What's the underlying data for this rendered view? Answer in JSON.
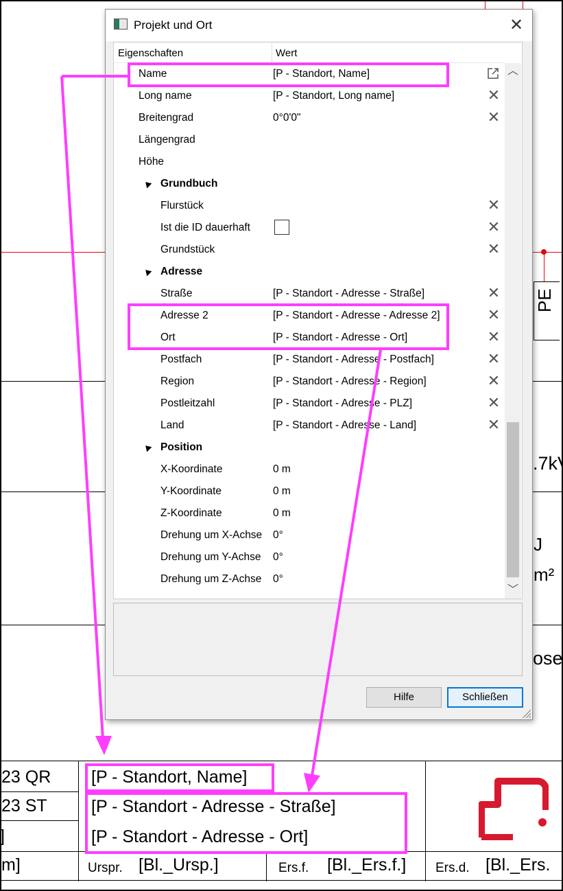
{
  "dialog": {
    "title": "Projekt und Ort",
    "header": {
      "col_properties": "Eigenschaften",
      "col_value": "Wert"
    },
    "rows": [
      {
        "label": "Name",
        "value": "[P - Standort, Name]"
      },
      {
        "label": "Long name",
        "value": "[P - Standort, Long name]"
      },
      {
        "label": "Breitengrad",
        "value": "0°0'0\""
      },
      {
        "label": "Längengrad",
        "value": ""
      },
      {
        "label": "Höhe",
        "value": ""
      },
      {
        "label": "Grundbuch",
        "value": ""
      },
      {
        "label": "Flurstück",
        "value": ""
      },
      {
        "label": "Ist die ID dauerhaft",
        "value": ""
      },
      {
        "label": "Grundstück",
        "value": ""
      },
      {
        "label": "Adresse",
        "value": ""
      },
      {
        "label": "Straße",
        "value": "[P - Standort - Adresse - Straße]"
      },
      {
        "label": "Adresse 2",
        "value": "[P - Standort - Adresse - Adresse 2]"
      },
      {
        "label": "Ort",
        "value": "[P - Standort - Adresse - Ort]"
      },
      {
        "label": "Postfach",
        "value": "[P - Standort - Adresse - Postfach]"
      },
      {
        "label": "Region",
        "value": "[P - Standort - Adresse - Region]"
      },
      {
        "label": "Postleitzahl",
        "value": "[P - Standort - Adresse - PLZ]"
      },
      {
        "label": "Land",
        "value": "[P - Standort - Adresse - Land]"
      },
      {
        "label": "Position",
        "value": ""
      },
      {
        "label": "X-Koordinate",
        "value": "0 m"
      },
      {
        "label": "Y-Koordinate",
        "value": "0 m"
      },
      {
        "label": "Z-Koordinate",
        "value": "0 m"
      },
      {
        "label": "Drehung um X-Achse",
        "value": "0°"
      },
      {
        "label": "Drehung um Y-Achse",
        "value": "0°"
      },
      {
        "label": "Drehung um Z-Achse",
        "value": "0°"
      }
    ],
    "buttons": {
      "help": "Hilfe",
      "close": "Schließen"
    }
  },
  "background": {
    "pe_label": "PE",
    "power_fragment": ".7kV",
    "unit_j": "J",
    "unit_m2": "m²",
    "fragment_ose": "ose"
  },
  "title_block": {
    "left_rows": [
      "23 QR",
      "23 ST",
      "]",
      "m]"
    ],
    "name_field": "[P - Standort, Name]",
    "street_field": "[P - Standort - Adresse - Straße]",
    "city_field": "[P - Standort - Adresse - Ort]",
    "urspr_label": "Urspr.",
    "urspr_value": "[Bl._Ursp.]",
    "ersf_label": "Ers.f.",
    "ersf_value": "[Bl._Ers.f.]",
    "ersd_label": "Ers.d.",
    "ersd_value": "[Bl._Ers."
  },
  "colors": {
    "highlight": "#ff3dff",
    "logo_red": "#d6192e",
    "wire_red": "#e1060e",
    "focus_blue": "#0078d7"
  },
  "icons": [
    "app-icon",
    "close-icon",
    "external-link-icon",
    "clear-icon",
    "collapse-triangle-icon",
    "scroll-up-icon",
    "scroll-down-icon",
    "resize-grip-icon"
  ]
}
